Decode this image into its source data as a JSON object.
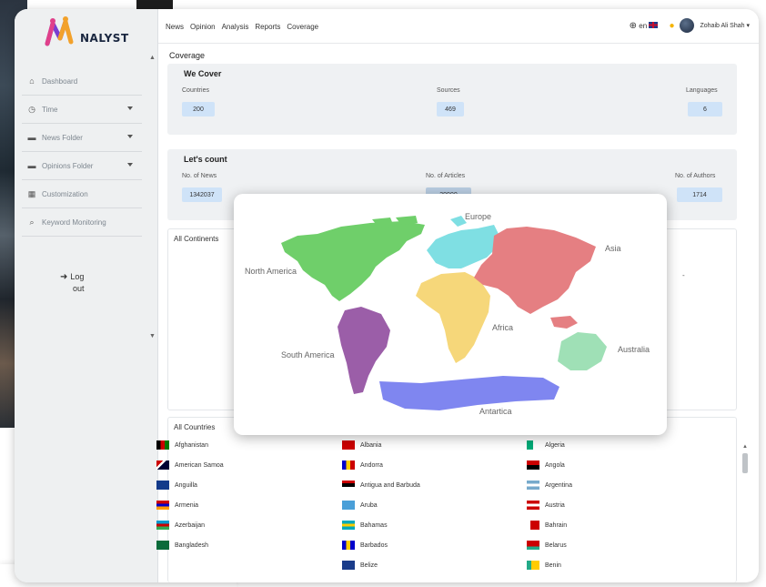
{
  "brand": {
    "name": "NALYST",
    "colors": {
      "accent": "#cfe3f8",
      "logo_pink": "#e0408a",
      "logo_purple": "#7a3fd0",
      "logo_orange": "#f2a12b"
    }
  },
  "sidebar": {
    "items": [
      {
        "label": "Dashboard",
        "icon": "home-icon",
        "has_caret": false
      },
      {
        "label": "Time",
        "icon": "clock-icon",
        "has_caret": true
      },
      {
        "label": "News Folder",
        "icon": "folder-icon",
        "has_caret": true
      },
      {
        "label": "Opinions Folder",
        "icon": "folder-icon",
        "has_caret": true
      },
      {
        "label": "Customization",
        "icon": "grid-icon",
        "has_caret": false
      },
      {
        "label": "Keyword Monitoring",
        "icon": "search-icon",
        "has_caret": false
      }
    ],
    "logout": {
      "line1": "Log",
      "line2": "out"
    }
  },
  "topbar": {
    "nav": [
      "News",
      "Opinion",
      "Analysis",
      "Reports",
      "Coverage"
    ],
    "language": "en",
    "user": "Zohaib Ali Shah"
  },
  "main": {
    "title": "Coverage",
    "we_cover": {
      "title": "We Cover",
      "stats": [
        {
          "label": "Countries",
          "value": "200"
        },
        {
          "label": "Sources",
          "value": "469"
        },
        {
          "label": "Languages",
          "value": "6"
        }
      ]
    },
    "lets_count": {
      "title": "Let's count",
      "stats": [
        {
          "label": "No. of News",
          "value": "1342037"
        },
        {
          "label": "No. of Articles",
          "value": "39990"
        },
        {
          "label": "No. of Authors",
          "value": "1714"
        }
      ]
    },
    "all_continents": {
      "title": "All Continents"
    },
    "all_countries": {
      "title": "All Countries",
      "rows": [
        [
          "Afghanistan",
          "Albania",
          "Algeria"
        ],
        [
          "American Samoa",
          "Andorra",
          "Angola"
        ],
        [
          "Anguilla",
          "Antigua and Barbuda",
          "Argentina"
        ],
        [
          "Armenia",
          "Aruba",
          "Austria"
        ],
        [
          "Azerbaijan",
          "Bahamas",
          "Bahrain"
        ],
        [
          "Bangladesh",
          "Barbados",
          "Belarus"
        ],
        [
          "",
          "Belize",
          "Benin"
        ]
      ]
    }
  },
  "map": {
    "continents": [
      {
        "name": "North America",
        "color": "#6fcf6a"
      },
      {
        "name": "South America",
        "color": "#9b5ea8"
      },
      {
        "name": "Europe",
        "color": "#7fdfe3"
      },
      {
        "name": "Africa",
        "color": "#f6d77a"
      },
      {
        "name": "Asia",
        "color": "#e57f82"
      },
      {
        "name": "Australia",
        "color": "#9fe0b6"
      },
      {
        "name": "Antartica",
        "color": "#7f86f0"
      }
    ]
  }
}
